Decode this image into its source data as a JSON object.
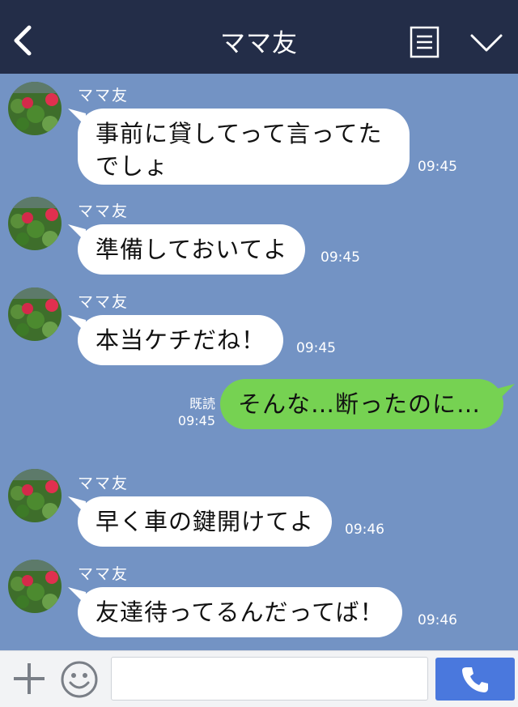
{
  "header": {
    "title": "ママ友"
  },
  "messages": [
    {
      "sender": "ママ友",
      "lines": [
        "事前に貸してって言ってた",
        "でしょ"
      ],
      "time": "09:45"
    },
    {
      "sender": "ママ友",
      "text": "準備しておいてよ",
      "time": "09:45"
    },
    {
      "sender": "ママ友",
      "text": "本当ケチだね！",
      "time": "09:45"
    },
    {
      "read_label": "既読",
      "time": "09:45",
      "text": "そんな…断ったのに…"
    },
    {
      "sender": "ママ友",
      "text": "早く車の鍵開けてよ",
      "time": "09:46"
    },
    {
      "sender": "ママ友",
      "text": "友達待ってるんだってば！",
      "time": "09:46"
    }
  ],
  "input": {
    "placeholder": "",
    "value": ""
  },
  "icons": [
    "back-icon",
    "menu-icon",
    "chevron-down-icon",
    "plus-icon",
    "smile-icon",
    "phone-icon"
  ],
  "colors": {
    "header": "#232d48",
    "chat_bg": "#7393c4",
    "outgoing": "#76d252",
    "call_button": "#4a78dd"
  }
}
